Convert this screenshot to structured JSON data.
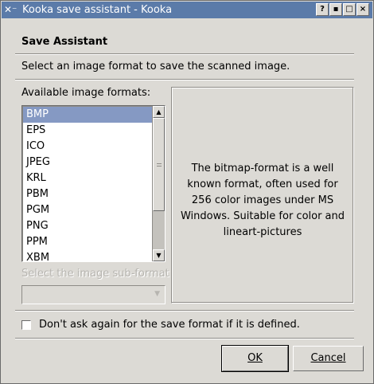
{
  "window": {
    "title": "Kooka save assistant - Kooka",
    "title_bar_color": "#5b7ba9",
    "icons": [
      "app-icon",
      "help-icon",
      "minimize-icon",
      "maximize-icon",
      "close-icon"
    ]
  },
  "header": {
    "title": "Save Assistant",
    "subtitle": "Select an image format to save the scanned image."
  },
  "formats": {
    "label": "Available image formats:",
    "items": [
      "BMP",
      "EPS",
      "ICO",
      "JPEG",
      "KRL",
      "PBM",
      "PGM",
      "PNG",
      "PPM",
      "XBM"
    ],
    "selected": "BMP",
    "selection_color": "#8599c3"
  },
  "description": {
    "text": "The bitmap-format is a well known format, often used for 256 color images under MS Windows. Suitable for color and lineart-pictures"
  },
  "subformat": {
    "label": "Select the image sub-format",
    "value": ""
  },
  "options": {
    "dont_ask_label": "Don't ask again for the save format if it is defined.",
    "dont_ask_checked": false
  },
  "buttons": {
    "ok": "OK",
    "cancel": "Cancel"
  }
}
